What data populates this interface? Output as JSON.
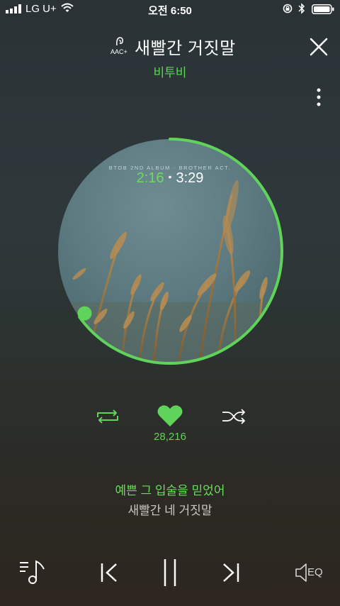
{
  "status_bar": {
    "carrier": "LG U+",
    "time": "오전 6:50"
  },
  "header": {
    "quality_badge": "AAC+",
    "song_title": "새빨간 거짓말",
    "artist": "비투비"
  },
  "album": {
    "cover_text": "BTOB 2ND ALBUM · BROTHER ACT.",
    "elapsed": "2:16",
    "duration": "3:29",
    "progress_fraction": 0.65
  },
  "actions": {
    "like_count": "28,216"
  },
  "lyrics": {
    "current_line": "예쁜 그 입술을 믿었어",
    "next_line": "새빨간 네 거짓말"
  },
  "player_bar": {
    "eq_label": "EQ"
  },
  "colors": {
    "accent": "#5fd35a"
  },
  "icons": [
    "signal-icon",
    "wifi-icon",
    "orientation-lock-icon",
    "bluetooth-icon",
    "battery-icon",
    "aac-icon",
    "close-icon",
    "more-icon",
    "repeat-icon",
    "heart-icon",
    "shuffle-icon",
    "playlist-icon",
    "previous-icon",
    "pause-icon",
    "next-icon",
    "eq-icon"
  ]
}
